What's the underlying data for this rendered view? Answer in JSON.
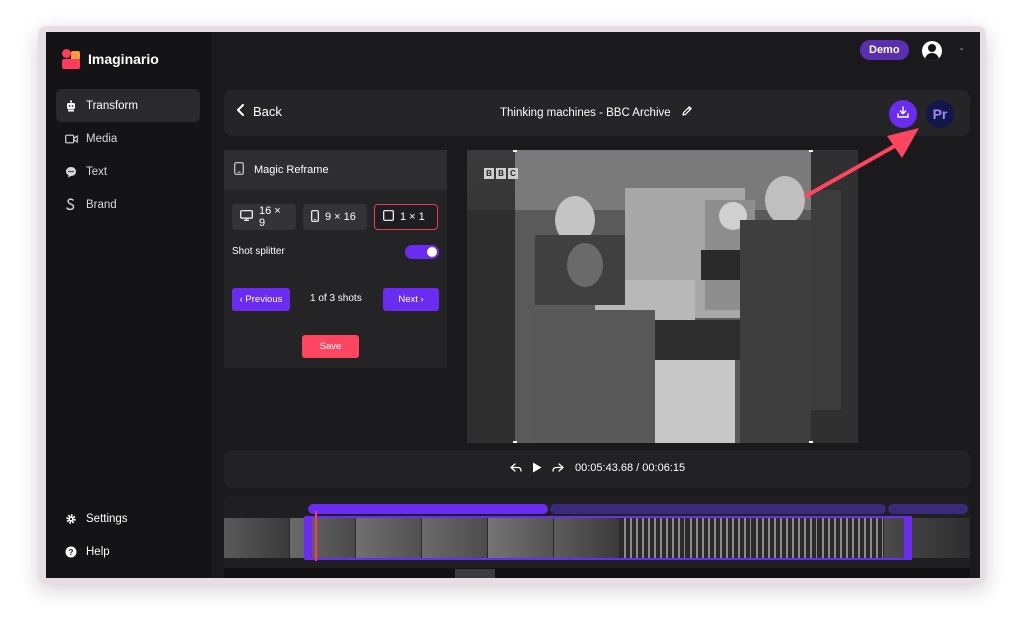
{
  "app": {
    "name": "Imaginario"
  },
  "sidebar": {
    "items": [
      {
        "label": "Transform",
        "icon": "robot-icon",
        "active": true
      },
      {
        "label": "Media",
        "icon": "video-camera-icon"
      },
      {
        "label": "Text",
        "icon": "chat-bubble-icon"
      },
      {
        "label": "Brand",
        "icon": "brand-squiggle-icon"
      }
    ],
    "bottom": [
      {
        "label": "Settings",
        "icon": "gear-icon"
      },
      {
        "label": "Help",
        "icon": "help-circle-icon"
      }
    ]
  },
  "topbar": {
    "workspace_badge": "Demo"
  },
  "header": {
    "back_label": "Back",
    "title": "Thinking machines - BBC Archive",
    "pr_label": "Pr"
  },
  "panel": {
    "title": "Magic Reframe",
    "ratios": [
      "16 × 9",
      "9 × 16",
      "1 × 1"
    ],
    "selected_ratio": "1 × 1",
    "shot_splitter_label": "Shot splitter",
    "shot_splitter_on": true,
    "prev_label": "‹ Previous",
    "shots_label": "1 of 3 shots",
    "next_label": "Next ›",
    "save_label": "Save"
  },
  "video": {
    "watermark": [
      "B",
      "B",
      "C"
    ]
  },
  "player": {
    "time": "00:05:43.68 / 00:06:15"
  },
  "colors": {
    "accent": "#6a2cf0",
    "danger": "#ff4560",
    "arrow": "#ff4560"
  }
}
